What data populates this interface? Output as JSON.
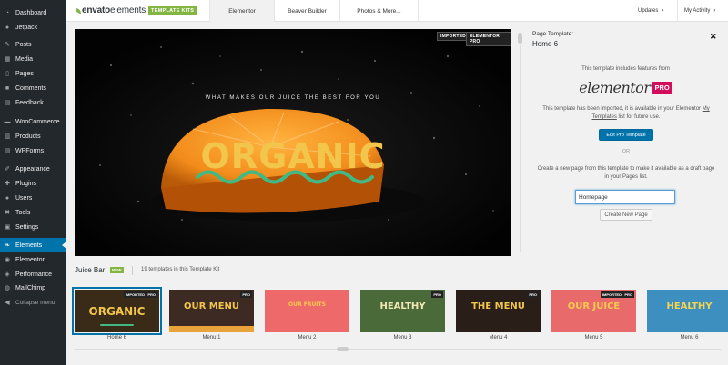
{
  "sidebar": {
    "items": [
      {
        "label": "Dashboard",
        "icon": "dashboard-icon",
        "glyph": "◔"
      },
      {
        "label": "Jetpack",
        "icon": "jetpack-icon",
        "glyph": "●"
      },
      {
        "label": "Posts",
        "icon": "pin-icon",
        "glyph": "✎"
      },
      {
        "label": "Media",
        "icon": "media-icon",
        "glyph": "▦"
      },
      {
        "label": "Pages",
        "icon": "pages-icon",
        "glyph": "▯"
      },
      {
        "label": "Comments",
        "icon": "comments-icon",
        "glyph": "■"
      },
      {
        "label": "Feedback",
        "icon": "feedback-icon",
        "glyph": "▤"
      },
      {
        "label": "WooCommerce",
        "icon": "woocommerce-icon",
        "glyph": "▬"
      },
      {
        "label": "Products",
        "icon": "products-icon",
        "glyph": "▥"
      },
      {
        "label": "WPForms",
        "icon": "wpforms-icon",
        "glyph": "▤"
      },
      {
        "label": "Appearance",
        "icon": "appearance-icon",
        "glyph": "✐"
      },
      {
        "label": "Plugins",
        "icon": "plugins-icon",
        "glyph": "✚"
      },
      {
        "label": "Users",
        "icon": "users-icon",
        "glyph": "●"
      },
      {
        "label": "Tools",
        "icon": "tools-icon",
        "glyph": "✖"
      },
      {
        "label": "Settings",
        "icon": "settings-icon",
        "glyph": "▣"
      },
      {
        "label": "Elements",
        "icon": "elements-leaf-icon",
        "glyph": "❧",
        "active": true
      },
      {
        "label": "Elementor",
        "icon": "elementor-icon",
        "glyph": "◉"
      },
      {
        "label": "Performance",
        "icon": "performance-icon",
        "glyph": "◈"
      },
      {
        "label": "MailChimp",
        "icon": "mailchimp-icon",
        "glyph": "◍"
      },
      {
        "label": "Collapse menu",
        "icon": "collapse-icon",
        "glyph": "◀",
        "collapse": true
      }
    ]
  },
  "topbar": {
    "logo_envato": "envato",
    "logo_elements": "elements",
    "logo_badge": "TEMPLATE KITS",
    "tabs": [
      "Elementor",
      "Beaver Builder",
      "Photos & More..."
    ],
    "updates": "Updates",
    "my_activity": "My Activity",
    "chevron": "›"
  },
  "preview": {
    "badge_imported": "IMPORTED",
    "badge_pro": "ELEMENTOR PRO",
    "subtitle": "WHAT MAKES OUR JUICE THE BEST FOR YOU",
    "title": "ORGANIC",
    "colors": {
      "title": "#f1c64a",
      "wave": "#42b883",
      "orange": "#f28c1b"
    }
  },
  "panel": {
    "page_template_label": "Page Template:",
    "page_template_name": "Home 6",
    "close_glyph": "✕",
    "features_text": "This template includes features from",
    "elementor_word": "elementor",
    "elementor_pro": "PRO",
    "imported_text_1": "This template has been imported, it is available in your Elementor ",
    "imported_link_1": "My",
    "imported_link_2": "Templates",
    "imported_text_2": " list for future use.",
    "edit_pro_button": "Edit Pro Template",
    "or_text": "OR",
    "create_text": "Create a new page from this template to make it available as a draft page in your Pages list.",
    "page_name_value": "Homepage",
    "create_button": "Create New Page"
  },
  "kit": {
    "name": "Juice Bar",
    "new_badge": "NEW",
    "count_text": "19 templates in this Template Kit"
  },
  "thumbnails": [
    {
      "label": "Home 6",
      "title": "ORGANIC",
      "badges": [
        "IMPORTED",
        "PRO"
      ],
      "bg": "#3a2a18",
      "color": "#f1c64a",
      "selected": true
    },
    {
      "label": "Menu 1",
      "title": "OUR MENU",
      "badges": [
        "PRO"
      ],
      "bg": "#3d2a22",
      "color": "#f1c64a",
      "band": "#e8a33b"
    },
    {
      "label": "Menu 2",
      "title": "OUR FRUITS",
      "badges": [],
      "bg": "#ee6a6a",
      "color": "#f6c950"
    },
    {
      "label": "Menu 3",
      "title": "HEALTHY",
      "badges": [
        "PRO"
      ],
      "bg": "#4a6a3a",
      "color": "#f3e7b4"
    },
    {
      "label": "Menu 4",
      "title": "THE MENU",
      "badges": [
        "PRO"
      ],
      "bg": "#2a1e18",
      "color": "#f1c64a"
    },
    {
      "label": "Menu 5",
      "title": "OUR JUICE",
      "badges": [
        "IMPORTED",
        "PRO"
      ],
      "bg": "#e86a6a",
      "color": "#f6c950"
    },
    {
      "label": "Menu 6",
      "title": "HEALTHY",
      "badges": [],
      "bg": "#3d8fc0",
      "color": "#f6d450"
    }
  ]
}
